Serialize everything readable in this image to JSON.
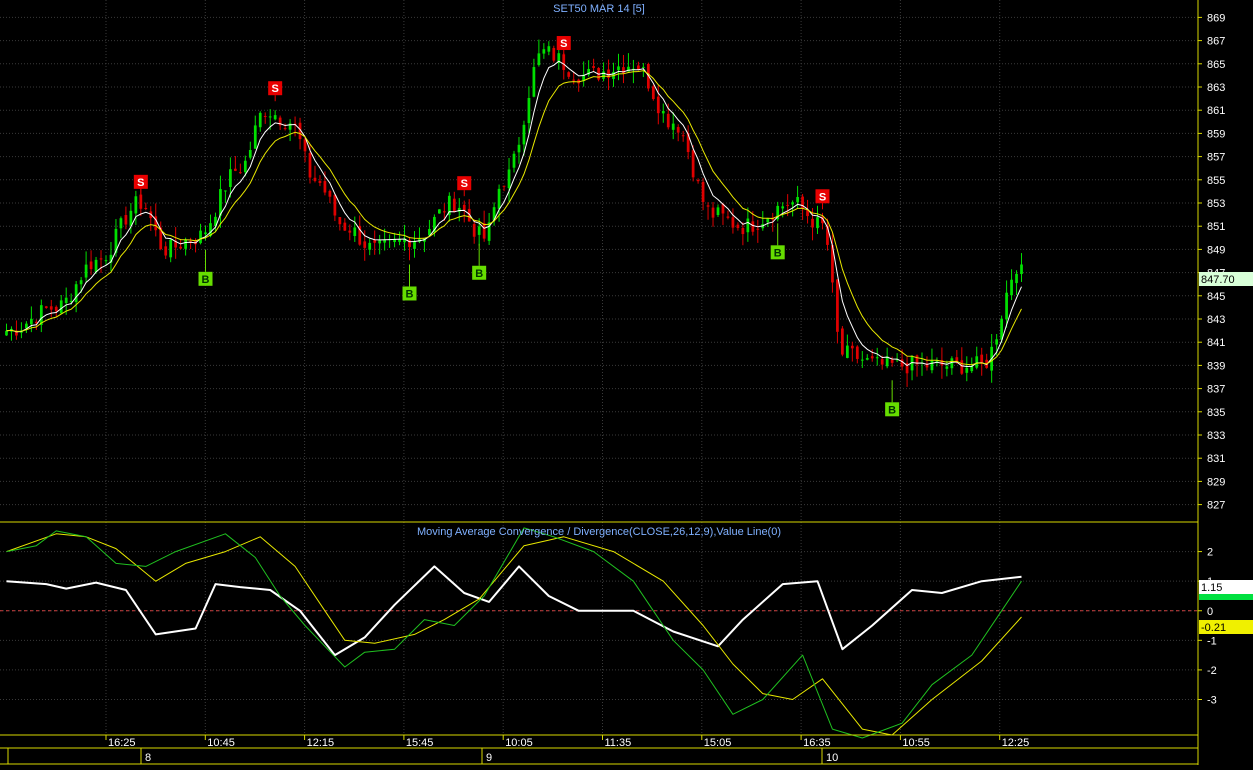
{
  "colors": {
    "background": "#000000",
    "grid": "#3a3a3a",
    "axis": "#d8d800",
    "bull": "#00e000",
    "bear": "#e00000",
    "ma_fast": "#ffffff",
    "ma_slow": "#e8e800",
    "signal_buy": "#66dd00",
    "signal_sell": "#e80000",
    "title": "#7fb0ff",
    "zero_line": "#d04040",
    "price_label_bg": "#d8ffd8"
  },
  "chart_data": [
    {
      "type": "candlestick",
      "title": "SET50 MAR 14   [5]",
      "ylim": [
        825.5,
        870.5
      ],
      "y_ticks": [
        869,
        867,
        865,
        863,
        861,
        859,
        857,
        855,
        853,
        851,
        849,
        847,
        845,
        843,
        841,
        839,
        837,
        835,
        833,
        831,
        829,
        827
      ],
      "last_price_label": "847.70",
      "last_price": 847.7,
      "n_bars": 205,
      "close_path": [
        {
          "i": 0,
          "v": 842
        },
        {
          "i": 10,
          "v": 844
        },
        {
          "i": 18,
          "v": 848
        },
        {
          "i": 27,
          "v": 853
        },
        {
          "i": 32,
          "v": 849
        },
        {
          "i": 38,
          "v": 850
        },
        {
          "i": 47,
          "v": 856
        },
        {
          "i": 52,
          "v": 861
        },
        {
          "i": 57,
          "v": 860
        },
        {
          "i": 62,
          "v": 855
        },
        {
          "i": 68,
          "v": 851
        },
        {
          "i": 74,
          "v": 849
        },
        {
          "i": 82,
          "v": 850
        },
        {
          "i": 90,
          "v": 853
        },
        {
          "i": 96,
          "v": 850
        },
        {
          "i": 100,
          "v": 855
        },
        {
          "i": 108,
          "v": 866
        },
        {
          "i": 116,
          "v": 864
        },
        {
          "i": 126,
          "v": 865
        },
        {
          "i": 134,
          "v": 860
        },
        {
          "i": 142,
          "v": 852
        },
        {
          "i": 148,
          "v": 851
        },
        {
          "i": 158,
          "v": 853
        },
        {
          "i": 164,
          "v": 851
        },
        {
          "i": 168,
          "v": 840
        },
        {
          "i": 176,
          "v": 839
        },
        {
          "i": 185,
          "v": 839
        },
        {
          "i": 196,
          "v": 839
        },
        {
          "i": 204,
          "v": 848
        }
      ],
      "signals": [
        {
          "type": "S",
          "bar": 27
        },
        {
          "type": "B",
          "bar": 40
        },
        {
          "type": "S",
          "bar": 54
        },
        {
          "type": "B",
          "bar": 81
        },
        {
          "type": "S",
          "bar": 92
        },
        {
          "type": "B",
          "bar": 95
        },
        {
          "type": "S",
          "bar": 112
        },
        {
          "type": "B",
          "bar": 155
        },
        {
          "type": "S",
          "bar": 164
        },
        {
          "type": "B",
          "bar": 178
        }
      ]
    },
    {
      "type": "line",
      "title": "Moving Average Convergence / Divergence(CLOSE,26,12,9),Value Line(0)",
      "ylim": [
        -4.2,
        3.0
      ],
      "y_ticks": [
        2,
        1,
        0,
        -1,
        -2,
        -3
      ],
      "value_line": 0,
      "labels": {
        "macd": "1.15",
        "signal": "-0.21"
      },
      "series": [
        {
          "key": "macd",
          "points": [
            [
              0,
              1.0
            ],
            [
              8,
              0.9
            ],
            [
              12,
              0.75
            ],
            [
              18,
              0.95
            ],
            [
              24,
              0.7
            ],
            [
              30,
              -0.8
            ],
            [
              38,
              -0.6
            ],
            [
              42,
              0.9
            ],
            [
              47,
              0.8
            ],
            [
              53,
              0.7
            ],
            [
              59,
              0.0
            ],
            [
              66,
              -1.5
            ],
            [
              72,
              -0.9
            ],
            [
              78,
              0.2
            ],
            [
              86,
              1.5
            ],
            [
              92,
              0.6
            ],
            [
              97,
              0.3
            ],
            [
              103,
              1.5
            ],
            [
              109,
              0.5
            ],
            [
              115,
              0.0
            ],
            [
              126,
              0.0
            ],
            [
              134,
              -0.7
            ],
            [
              143,
              -1.2
            ],
            [
              148,
              -0.3
            ],
            [
              156,
              0.9
            ],
            [
              163,
              1.0
            ],
            [
              168,
              -1.3
            ],
            [
              174,
              -0.5
            ],
            [
              182,
              0.7
            ],
            [
              188,
              0.6
            ],
            [
              196,
              1.0
            ],
            [
              204,
              1.15
            ]
          ]
        },
        {
          "key": "signal",
          "points": [
            [
              0,
              2.0
            ],
            [
              10,
              2.6
            ],
            [
              16,
              2.5
            ],
            [
              22,
              2.1
            ],
            [
              30,
              1.0
            ],
            [
              36,
              1.6
            ],
            [
              44,
              2.0
            ],
            [
              51,
              2.5
            ],
            [
              58,
              1.5
            ],
            [
              64,
              0.0
            ],
            [
              68,
              -1.0
            ],
            [
              74,
              -1.1
            ],
            [
              82,
              -0.8
            ],
            [
              88,
              -0.3
            ],
            [
              95,
              0.4
            ],
            [
              104,
              2.2
            ],
            [
              112,
              2.5
            ],
            [
              122,
              2.0
            ],
            [
              132,
              1.0
            ],
            [
              140,
              -0.5
            ],
            [
              146,
              -1.8
            ],
            [
              152,
              -2.8
            ],
            [
              158,
              -3.0
            ],
            [
              164,
              -2.3
            ],
            [
              172,
              -4.0
            ],
            [
              178,
              -4.2
            ],
            [
              186,
              -3.0
            ],
            [
              196,
              -1.7
            ],
            [
              204,
              -0.21
            ]
          ]
        },
        {
          "key": "histogram",
          "points": [
            [
              0,
              2.0
            ],
            [
              6,
              2.2
            ],
            [
              10,
              2.7
            ],
            [
              16,
              2.5
            ],
            [
              22,
              1.6
            ],
            [
              28,
              1.5
            ],
            [
              34,
              2.0
            ],
            [
              44,
              2.6
            ],
            [
              50,
              1.8
            ],
            [
              55,
              0.5
            ],
            [
              60,
              -0.5
            ],
            [
              64,
              -1.2
            ],
            [
              68,
              -1.9
            ],
            [
              72,
              -1.4
            ],
            [
              78,
              -1.3
            ],
            [
              84,
              -0.3
            ],
            [
              90,
              -0.5
            ],
            [
              96,
              0.5
            ],
            [
              104,
              2.8
            ],
            [
              110,
              2.5
            ],
            [
              118,
              2.0
            ],
            [
              126,
              1.0
            ],
            [
              134,
              -1.0
            ],
            [
              140,
              -2.0
            ],
            [
              146,
              -3.5
            ],
            [
              152,
              -3.0
            ],
            [
              160,
              -1.5
            ],
            [
              166,
              -4.0
            ],
            [
              172,
              -4.3
            ],
            [
              180,
              -3.8
            ],
            [
              186,
              -2.5
            ],
            [
              194,
              -1.5
            ],
            [
              200,
              0.0
            ],
            [
              204,
              1.0
            ]
          ]
        }
      ]
    }
  ],
  "time_axis": {
    "labels": [
      "16:25",
      "10:45",
      "12:15",
      "15:45",
      "10:05",
      "11:35",
      "15:05",
      "16:35",
      "10:55",
      "12:25"
    ],
    "dates": [
      "8",
      "9",
      "10"
    ]
  }
}
